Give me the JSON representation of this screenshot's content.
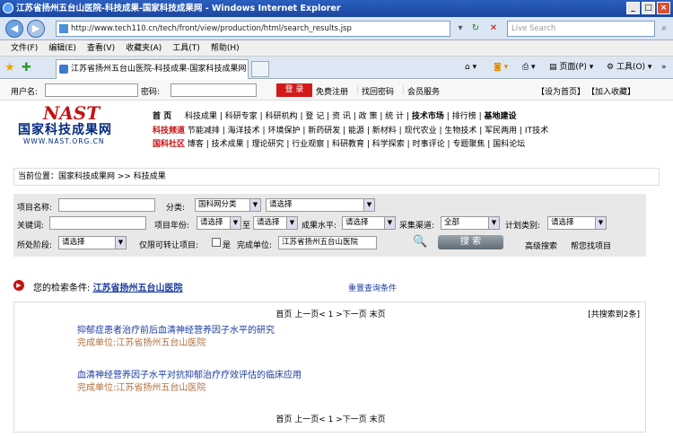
{
  "window": {
    "title": "江苏省扬州五台山医院-科技成果-国家科技成果网 - Windows Internet Explorer"
  },
  "browser": {
    "url": "http://www.tech110.cn/tech/front/view/production/html/search_results.jsp",
    "search_placeholder": "Live Search",
    "menu": [
      "文件(F)",
      "编辑(E)",
      "查看(V)",
      "收藏夹(A)",
      "工具(T)",
      "帮助(H)"
    ],
    "tab_title": "江苏省扬州五台山医院-科技成果-国家科技成果网",
    "cmd_page": "页面(P)",
    "cmd_tools": "工具(O)"
  },
  "login": {
    "username_label": "用户名:",
    "password_label": "密码:",
    "login_button": "登 录",
    "register": "免费注册",
    "forgot": "找回密码",
    "member": "会员服务",
    "set_home": "【设为首页】",
    "add_fav": "【加入收藏】"
  },
  "logo": {
    "nast": "NAST",
    "cn": "国家科技成果网",
    "url": "WWW.NAST.ORG.CN"
  },
  "nav": {
    "row1": [
      "首  页",
      "科技成果",
      "科研专家",
      "科研机构",
      "登 记",
      "资 讯",
      "政 策",
      "统 计",
      "技术市场",
      "排行榜",
      "基地建设"
    ],
    "row2": [
      "科技频道",
      "节能减排",
      "海洋技术",
      "环境保护",
      "新药研发",
      "能源",
      "新材料",
      "现代农业",
      "生物技术",
      "军民两用",
      "IT技术"
    ],
    "row3": [
      "国科社区",
      "博客",
      "技术成果",
      "理论研究",
      "行业观察",
      "科研教育",
      "科学探索",
      "时事评论",
      "专题聚焦",
      "国科论坛"
    ]
  },
  "breadcrumb": "当前位置：国家科技成果网 >> 科技成果",
  "form": {
    "name_label": "项目名称:",
    "category_label": "分类:",
    "category1": "国科网分类",
    "category2": "请选择",
    "keyword_label": "关键词:",
    "year_label": "项目年份:",
    "year_from": "请选择",
    "year_to_label": "至",
    "year_to": "请选择",
    "level_label": "成果水平:",
    "level": "请选择",
    "channel_label": "采集渠道:",
    "channel": "全部",
    "plan_label": "计划类别:",
    "plan": "请选择",
    "stage_label": "所处阶段:",
    "stage": "请选择",
    "transfer_label": "仅限可转让项目:",
    "transfer_yes": "是",
    "unit_label": "完成单位:",
    "unit_value": "江苏省扬州五台山医院",
    "search_button": "搜 索",
    "advanced": "高级搜索",
    "help": "帮您找项目"
  },
  "conditions": {
    "label": "您的检索条件:",
    "value": "江苏省扬州五台山医院",
    "reset": "重置查询条件"
  },
  "results": {
    "pager_top": "首页  上一页< 1 >下一页  末页",
    "pager_bottom": "首页  上一页< 1 >下一页  末页",
    "total": "[共搜索到2条]",
    "items": [
      {
        "title": "抑郁症患者治疗前后血清神经营养因子水平的研究",
        "unit": "完成单位:江苏省扬州五台山医院"
      },
      {
        "title": "血清神经营养因子水平对抗抑郁治疗疗效评估的临床应用",
        "unit": "完成单位:江苏省扬州五台山医院"
      }
    ]
  }
}
